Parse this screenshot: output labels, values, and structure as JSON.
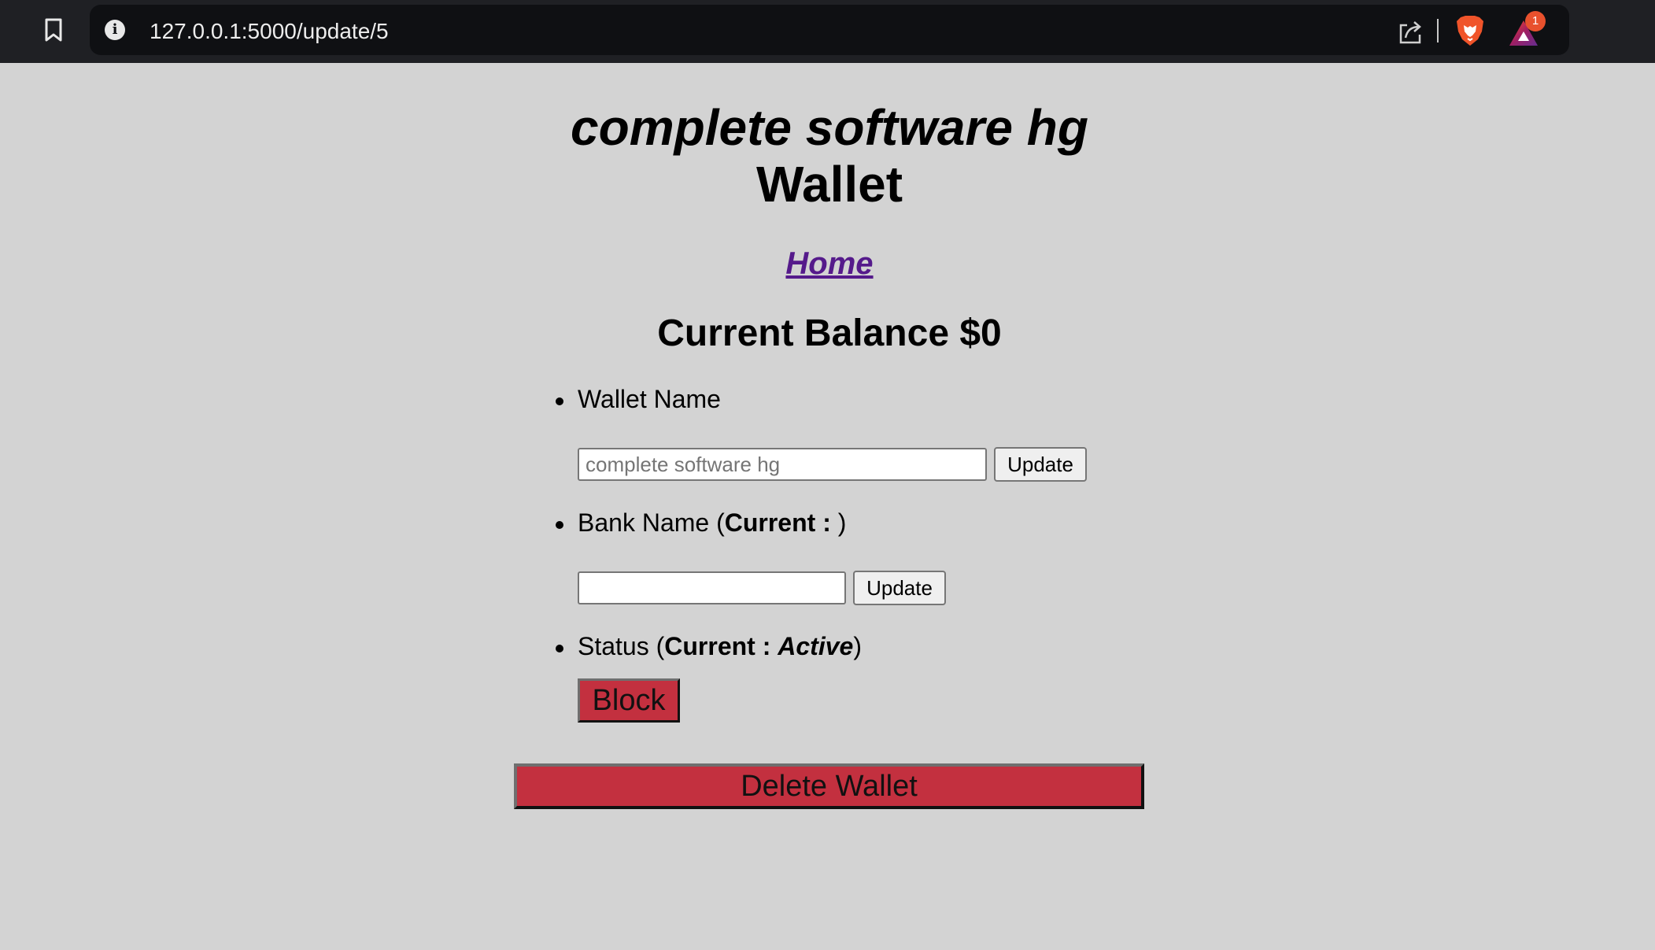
{
  "browser": {
    "url": "127.0.0.1:5000/update/5",
    "rewards_badge": "1",
    "icons": [
      "bookmark-icon",
      "info-icon",
      "share-icon",
      "brave-lion-icon",
      "brave-rewards-icon"
    ]
  },
  "page": {
    "title_italic": "complete software hg",
    "title_wallet": "Wallet",
    "home_link": "Home",
    "balance": "Current Balance $0"
  },
  "wallet_name": {
    "label": "Wallet Name",
    "placeholder": "complete software hg",
    "button": "Update"
  },
  "bank_name": {
    "label_prefix": "Bank Name (",
    "current_label": "Current : ",
    "current_value": "",
    "label_suffix": ")",
    "placeholder": "",
    "button": "Update"
  },
  "status": {
    "label_prefix": "Status (",
    "current_label": "Current : ",
    "current_value": "Active",
    "label_suffix": ")",
    "button": "Block"
  },
  "delete_button": "Delete Wallet",
  "colors": {
    "page_background": "#d3d3d3",
    "danger_button": "#c3303f",
    "link": "#551a8b",
    "browser_chrome": "#1f2024"
  }
}
